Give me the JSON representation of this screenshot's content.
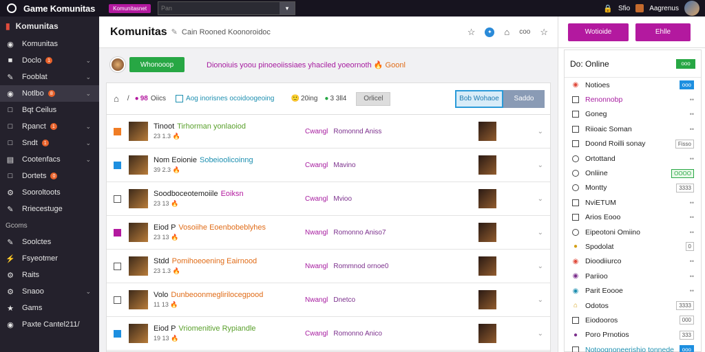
{
  "topbar": {
    "app_title": "Game Komunitas",
    "brand_pill": "Komunitasnet",
    "search_placeholder": "Pan",
    "search_dropdown": "▾",
    "right_label_1": "Sfio",
    "right_label_2": "Aagrenus"
  },
  "sidebar": {
    "header": "Komunitas",
    "items": [
      {
        "label": "Komunitas",
        "icon": "community-icon"
      },
      {
        "label": "Doclo",
        "badge": "1",
        "icon": "file-icon"
      },
      {
        "label": "Fooblat",
        "icon": "tag-icon"
      },
      {
        "label": "Notlbo",
        "badge": "8",
        "icon": "circle-icon"
      },
      {
        "label": "Bqt Ceilus",
        "icon": "doc-icon"
      },
      {
        "label": "Rpanct",
        "badge": "1",
        "icon": "doc-icon"
      },
      {
        "label": "Sndt",
        "badge": "1",
        "icon": "doc-icon"
      },
      {
        "label": "Cootenfacs",
        "icon": "folder-icon"
      },
      {
        "label": "Dortets",
        "badge": "0",
        "icon": "doc-icon"
      },
      {
        "label": "Sooroltoots",
        "icon": "gear-icon"
      },
      {
        "label": "Rriecestuge",
        "icon": "pin-icon"
      }
    ],
    "section": "Gcoms",
    "section_items": [
      {
        "label": "Soolctes",
        "icon": "gamepad-icon"
      },
      {
        "label": "Fsyeotmer",
        "icon": "bolt-icon"
      },
      {
        "label": "Raits",
        "icon": "gear-icon"
      },
      {
        "label": "Snaoo",
        "icon": "gear-icon"
      },
      {
        "label": "Gams",
        "icon": "star-icon"
      },
      {
        "label": "Paxte Cantel211/",
        "icon": "circle-icon"
      }
    ]
  },
  "header": {
    "title": "Komunitas",
    "subtitle": "Cain Rooned Koonoroidoc",
    "icon_label": "coo"
  },
  "info": {
    "button_label": "Whonooop",
    "promo_text": "Dionoiuis yoou pinoeoiissiaes yhaciled yoeornoth",
    "promo_accent": "Goonl"
  },
  "toolbar": {
    "count_label": "98",
    "count_text": "Oiics",
    "filter_label": "Aog inorisnes ocoidoogeoing",
    "emoji_count": "20ing",
    "count2": "3 3ll4",
    "grey_button": "Orlicel",
    "blue_button": "Bob Wohaoe",
    "blue_button2": "Saddo"
  },
  "rows": [
    {
      "title": "Tinoot",
      "highlight": "Tirhorman yonlaoiod",
      "meta": "23 1.3",
      "cat1": "Cwangl",
      "cat2": "Romonnd Aniss",
      "cb": "orange",
      "hl_color": "#5aa02c"
    },
    {
      "title": "Nom Eoionie",
      "highlight": "Sobeioolicoinng",
      "meta": "39 2.3",
      "cat1": "Cwangl",
      "cat2": "Mavino",
      "cb": "blue",
      "hl_color": "#1d8fb0"
    },
    {
      "title": "Soodboceotemoiile",
      "highlight": "Eoiksn",
      "meta": "23 13",
      "cat1": "Cwangl",
      "cat2": "Mvioo",
      "cb": "none",
      "hl_color": "#b3199f"
    },
    {
      "title": "Eiod P",
      "highlight": "Vosoiihe Eoenbobeblyhes",
      "meta": "23 13",
      "cat1": "Nwangl",
      "cat2": "Romonno Aniso7",
      "cb": "purple",
      "hl_color": "#e06c18"
    },
    {
      "title": "Stdd",
      "highlight": "Pomihoeoening Eairnood",
      "meta": "23 1.3",
      "cat1": "Nwangl",
      "cat2": "Rommnod ornoe0",
      "cb": "none",
      "hl_color": "#e06c18"
    },
    {
      "title": "Volo",
      "highlight": "Dunbeoonmeglirilocegpood",
      "meta": "11 13",
      "cat1": "Nwangl",
      "cat2": "Dnetco",
      "cb": "none",
      "hl_color": "#e06c18"
    },
    {
      "title": "Eiod P",
      "highlight": "Vriomenitive Rypiandle",
      "meta": "19 13",
      "cat1": "Cwangl",
      "cat2": "Romonno Anico",
      "cb": "blue",
      "hl_color": "#5aa02c"
    }
  ],
  "right": {
    "button1": "Wotioide",
    "button2": "Ehlle",
    "online_title": "Do: Online",
    "online_badge": "ooo",
    "list": [
      {
        "label": "Notioes",
        "icon": "globe-icon",
        "tag": "ooo",
        "tag_style": "blue"
      },
      {
        "label": "Renonnobp",
        "icon": "square-icon",
        "color": "pur"
      },
      {
        "label": "Goneg",
        "icon": "square-icon"
      },
      {
        "label": "Riioaic Soman",
        "icon": "square-icon"
      },
      {
        "label": "Doond Roilli sonay",
        "icon": "square-icon",
        "tag": "Fisso",
        "tag_style": "plain"
      },
      {
        "label": "Ortottand",
        "icon": "ring-icon"
      },
      {
        "label": "Onliine",
        "icon": "ring-icon",
        "tag": "OOOO",
        "tag_style": "green"
      },
      {
        "label": "Montty",
        "icon": "ring-icon",
        "tag": "3333",
        "tag_style": "plain"
      },
      {
        "label": "NviETUM",
        "icon": "square-icon"
      },
      {
        "label": "Arios Eooo",
        "icon": "square-icon"
      },
      {
        "label": "Eipeotoni Omiino",
        "icon": "ring-icon"
      },
      {
        "label": "Spodolat",
        "icon": "dot-icon",
        "tag": "0",
        "tag_style": "plain"
      },
      {
        "label": "Dioodiiurco",
        "icon": "globe-icon"
      },
      {
        "label": "Pariioo",
        "icon": "globe-icon"
      },
      {
        "label": "Parit Eoooe",
        "icon": "globe-icon"
      },
      {
        "label": "Odotos",
        "icon": "bell-icon",
        "tag": "3333",
        "tag_style": "plain"
      },
      {
        "label": "Eiodooros",
        "icon": "square-icon",
        "tag": "000",
        "tag_style": "plain"
      },
      {
        "label": "Poro Prnotios",
        "icon": "dot-icon",
        "tag": "333",
        "tag_style": "plain"
      },
      {
        "label": "Notoognoneerishio tonnede",
        "icon": "square-icon",
        "color": "blu",
        "tag": "ooo",
        "tag_style": "blue"
      }
    ]
  },
  "colors": {
    "accent": "#b3199f",
    "green": "#27a744",
    "blue": "#1d8fe0",
    "sidebar_bg": "#24212c"
  }
}
